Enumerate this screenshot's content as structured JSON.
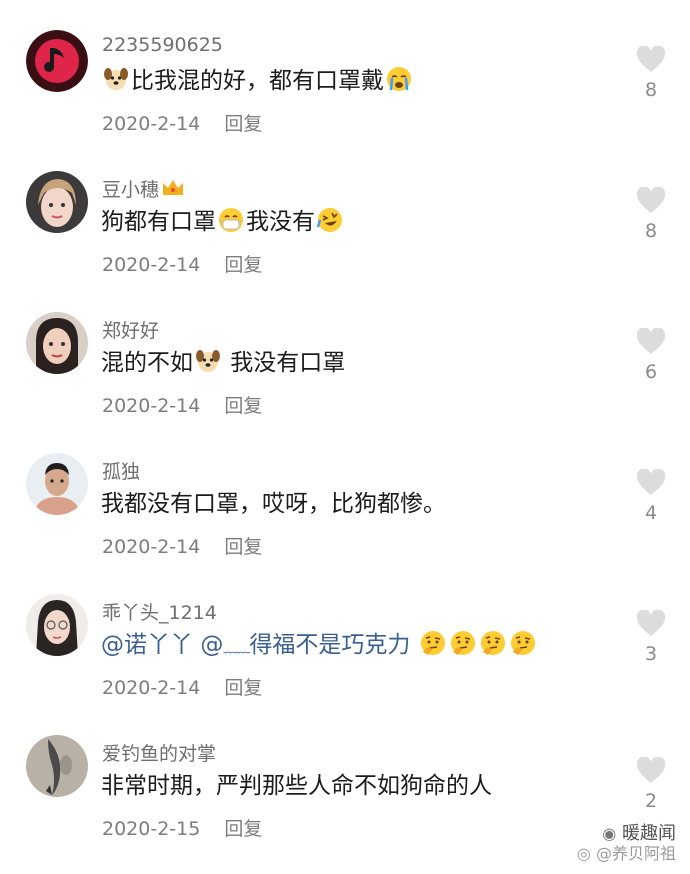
{
  "comments": [
    {
      "username": "2235590625",
      "text_parts": [
        "比我混的好，都有口罩戴"
      ],
      "date": "2020-2-14",
      "reply_label": "回复",
      "likes": "8",
      "avatar": "music-note-avatar"
    },
    {
      "username": "豆小穗",
      "text_parts": [
        "狗都有口罩",
        "我没有"
      ],
      "date": "2020-2-14",
      "reply_label": "回复",
      "likes": "8",
      "avatar": "girl-photo-avatar"
    },
    {
      "username": "郑好好",
      "text_parts": [
        "混的不如",
        " 我没有口罩"
      ],
      "date": "2020-2-14",
      "reply_label": "回复",
      "likes": "6",
      "avatar": "woman-photo-avatar"
    },
    {
      "username": "孤独",
      "text_parts": [
        "我都没有口罩，哎呀，比狗都惨。"
      ],
      "date": "2020-2-14",
      "reply_label": "回复",
      "likes": "4",
      "avatar": "man-photo-avatar"
    },
    {
      "username": "乖丫头_1214",
      "text_parts": [
        "@诺丫丫 @",
        "得福不是巧克力"
      ],
      "mention_1": "@诺丫丫",
      "mention_2": "@",
      "date": "2020-2-14",
      "reply_label": "回复",
      "likes": "3",
      "avatar": "glasses-girl-avatar"
    },
    {
      "username": "爱钓鱼的对掌",
      "text_parts": [
        "非常时期，严判那些人命不如狗命的人"
      ],
      "date": "2020-2-15",
      "reply_label": "回复",
      "likes": "2",
      "avatar": "fish-avatar"
    }
  ],
  "watermark": {
    "line1": "暖趣闻",
    "line2": "@养贝阿祖"
  },
  "colors": {
    "username": "#6f6f6f",
    "text": "#1c1c1c",
    "meta": "#7d7d7d",
    "mention": "#3a5f8f",
    "heart": "#dcdcdc"
  }
}
